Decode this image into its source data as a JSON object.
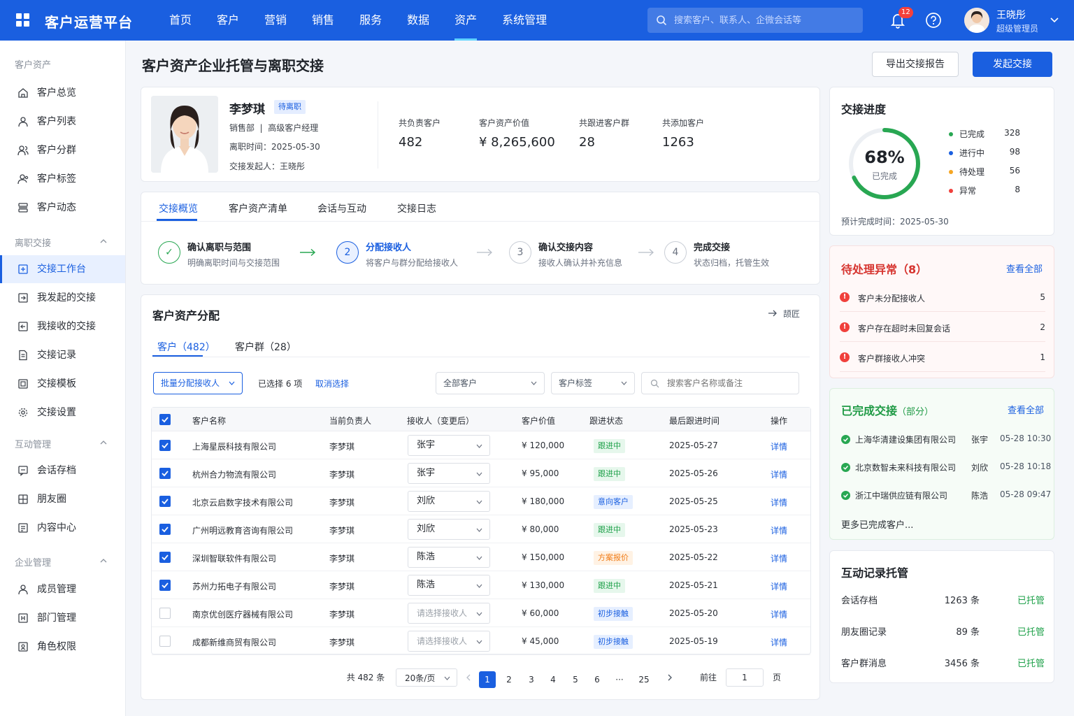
{
  "app": {
    "title": "客户运营平台"
  },
  "nav": [
    "首页",
    "客户",
    "营销",
    "销售",
    "服务",
    "数据",
    "资产",
    "系统管理"
  ],
  "nav_active": 6,
  "search": {
    "placeholder": "搜索客户、联系人、企微会话等"
  },
  "notifications": {
    "count": "12"
  },
  "user": {
    "name": "王晓彤",
    "role": "超级管理员"
  },
  "sidebar": {
    "group1": "客户资产",
    "items1": [
      "客户总览",
      "客户列表",
      "客户分群",
      "客户标签",
      "客户动态"
    ],
    "group2": "离职交接",
    "items2": [
      "交接工作台",
      "我发起的交接",
      "我接收的交接",
      "交接记录",
      "交接模板",
      "交接设置"
    ],
    "group3": "互动管理",
    "items3": [
      "会话存档",
      "朋友圈",
      "内容中心"
    ],
    "group4": "企业管理",
    "items4": [
      "成员管理",
      "部门管理",
      "角色权限"
    ]
  },
  "page": {
    "title": "客户资产企业托管与离职交接",
    "export_label": "导出交接报告",
    "start_label": "发起交接"
  },
  "employee": {
    "name": "李梦琪",
    "tag": "待离职",
    "dept": "销售部  |  高级客户经理",
    "leave": "离职时间：2025-05-30",
    "initiator": "交接发起人：王晓彤",
    "stats": [
      {
        "label": "共负责客户",
        "value": "482"
      },
      {
        "label": "客户资产价值",
        "value": "¥ 8,265,600"
      },
      {
        "label": "共跟进客户群",
        "value": "28"
      },
      {
        "label": "共添加客户",
        "value": "1263"
      }
    ]
  },
  "tabs": [
    "交接概览",
    "客户资产清单",
    "会话与互动",
    "交接日志"
  ],
  "steps": [
    {
      "num": "✓",
      "title": "确认离职与范围",
      "desc": "明确离职时间与交接范围"
    },
    {
      "num": "2",
      "title": "分配接收人",
      "desc": "将客户与群分配给接收人"
    },
    {
      "num": "3",
      "title": "确认交接内容",
      "desc": "接收人确认并补充信息"
    },
    {
      "num": "4",
      "title": "完成交接",
      "desc": "状态归档，托管生效"
    }
  ],
  "alloc": {
    "title": "客户资产分配",
    "collapse": "颉匠",
    "subtabs": [
      "客户（482）",
      "客户群（28）"
    ],
    "batch_label": "批量分配接收人",
    "selected_text": "已选择 6 项",
    "cancel_label": "取消选择",
    "filter1": "全部客户",
    "filter2": "客户标签",
    "search_placeholder": "搜索客户名称或备注",
    "columns": [
      "客户名称",
      "当前负责人",
      "接收人（变更后）",
      "客户价值",
      "跟进状态",
      "最后跟进时间",
      "操作"
    ],
    "rows": [
      {
        "checked": true,
        "name": "上海星辰科技有限公司",
        "owner": "李梦琪",
        "receiver": "张宇",
        "value": "¥ 120,000",
        "status": "跟进中",
        "color": "green",
        "date": "2025-05-27",
        "op": "详情"
      },
      {
        "checked": true,
        "name": "杭州合力物流有限公司",
        "owner": "李梦琪",
        "receiver": "张宇",
        "value": "¥ 95,000",
        "status": "跟进中",
        "color": "green",
        "date": "2025-05-26",
        "op": "详情"
      },
      {
        "checked": true,
        "name": "北京云启数字技术有限公司",
        "owner": "李梦琪",
        "receiver": "刘欣",
        "value": "¥ 180,000",
        "status": "意向客户",
        "color": "blue",
        "date": "2025-05-25",
        "op": "详情"
      },
      {
        "checked": true,
        "name": "广州明远教育咨询有限公司",
        "owner": "李梦琪",
        "receiver": "刘欣",
        "value": "¥ 80,000",
        "status": "跟进中",
        "color": "green",
        "date": "2025-05-23",
        "op": "详情"
      },
      {
        "checked": true,
        "name": "深圳智联软件有限公司",
        "owner": "李梦琪",
        "receiver": "陈浩",
        "value": "¥ 150,000",
        "status": "方案报价",
        "color": "orange",
        "date": "2025-05-22",
        "op": "详情"
      },
      {
        "checked": true,
        "name": "苏州力拓电子有限公司",
        "owner": "李梦琪",
        "receiver": "陈浩",
        "value": "¥ 130,000",
        "status": "跟进中",
        "color": "green",
        "date": "2025-05-21",
        "op": "详情"
      },
      {
        "checked": false,
        "name": "南京优创医疗器械有限公司",
        "owner": "李梦琪",
        "receiver": "请选择接收人",
        "value": "¥ 60,000",
        "status": "初步接触",
        "color": "blue",
        "date": "2025-05-20",
        "op": "详情"
      },
      {
        "checked": false,
        "name": "成都新维商贸有限公司",
        "owner": "李梦琪",
        "receiver": "请选择接收人",
        "value": "¥ 45,000",
        "status": "初步接触",
        "color": "blue",
        "date": "2025-05-19",
        "op": "详情"
      }
    ],
    "pagination": {
      "total": "共 482 条",
      "size": "20条/页",
      "pages": [
        "1",
        "2",
        "3",
        "4",
        "5",
        "6",
        "···",
        "25"
      ],
      "goto": "前往",
      "goto_value": "1",
      "unit": "页"
    }
  },
  "progress": {
    "title": "交接进度",
    "percent": 68,
    "percent_text": "68%",
    "sub": "已完成",
    "legend": [
      {
        "label": "已完成",
        "value": "328",
        "color": "#28a752"
      },
      {
        "label": "进行中",
        "value": "98",
        "color": "#1a5fe0"
      },
      {
        "label": "待处理",
        "value": "56",
        "color": "#f5a623"
      },
      {
        "label": "异常",
        "value": "8",
        "color": "#f0403c"
      }
    ],
    "eta": "预计完成时间：2025-05-30"
  },
  "exceptions": {
    "title": "待处理异常（8）",
    "view_all": "查看全部",
    "items": [
      {
        "label": "客户未分配接收人",
        "count": "5"
      },
      {
        "label": "客户存在超时未回复会话",
        "count": "2"
      },
      {
        "label": "客户群接收人冲突",
        "count": "1"
      }
    ]
  },
  "completed": {
    "title": "已完成交接",
    "sub": "（部分）",
    "view_all": "查看全部",
    "items": [
      {
        "company": "上海华清建设集团有限公司",
        "person": "张宇",
        "time": "05-28 10:30"
      },
      {
        "company": "北京数智未来科技有限公司",
        "person": "刘欣",
        "time": "05-28 10:18"
      },
      {
        "company": "浙江中瑞供应链有限公司",
        "person": "陈浩",
        "time": "05-28 09:47"
      }
    ],
    "more": "更多已完成客户..."
  },
  "custody": {
    "title": "互动记录托管",
    "items": [
      {
        "label": "会话存档",
        "value": "1263 条",
        "status": "已托管"
      },
      {
        "label": "朋友圈记录",
        "value": "89 条",
        "status": "已托管"
      },
      {
        "label": "客户群消息",
        "value": "3456 条",
        "status": "已托管"
      }
    ]
  }
}
